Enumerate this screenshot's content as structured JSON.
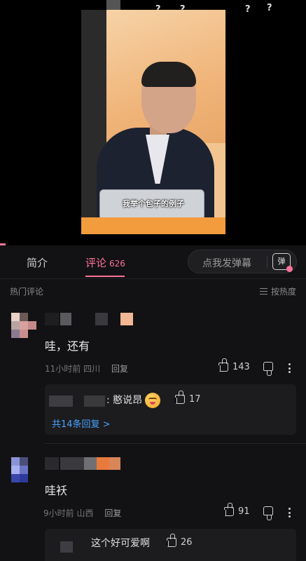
{
  "video": {
    "subtitle": "我举个包子的例子",
    "danmaku_marks": [
      "?",
      "?",
      "?",
      "?",
      "?"
    ]
  },
  "tabs": {
    "intro": "简介",
    "comments": "评论",
    "comments_count": "626",
    "danmu_placeholder": "点我发弹幕",
    "danmu_icon": "弹"
  },
  "section": {
    "title": "热门评论",
    "sort_label": "按热度"
  },
  "comments": [
    {
      "text": "哇，还有",
      "time": "11小时前",
      "location": "四川",
      "reply_label": "回复",
      "likes": "143",
      "reply_preview": {
        "text": "憨说昂",
        "likes": "17",
        "expand": "共14条回复 >"
      }
    },
    {
      "text": "哇袄",
      "time": "9小时前",
      "location": "山西",
      "reply_label": "回复",
      "likes": "91",
      "reply_preview": {
        "text": "这个好可爱啊",
        "likes": "26"
      }
    }
  ],
  "colors": {
    "accent": "#fb7299",
    "link": "#4aa3ff",
    "background": "#121214"
  }
}
